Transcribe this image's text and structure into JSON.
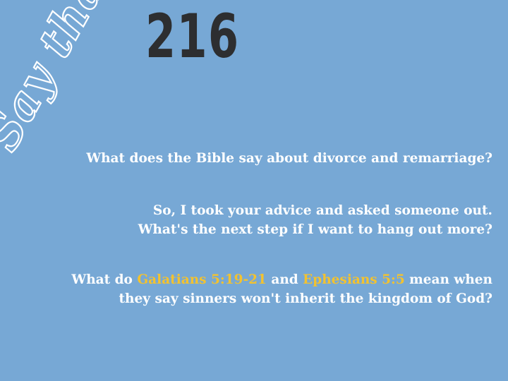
{
  "logo": {
    "text": "Say that."
  },
  "episode": {
    "number": "216"
  },
  "questions": {
    "q1": {
      "line1": "What does the Bible say about divorce and remarriage?"
    },
    "q2": {
      "line1": "So, I took your advice and asked someone out.",
      "line2": "What's the next step if I want to hang out more?"
    },
    "q3": {
      "line1_prefix": "What do ",
      "ref1": "Galatians 5:19-21",
      "line1_middle": " and ",
      "ref2": "Ephesians 5:5",
      "line1_suffix": " mean when",
      "line2": "they say sinners won't inherit the kingdom of God?"
    }
  },
  "colors": {
    "background": "#77a8d5",
    "number": "#2d2e30",
    "text": "#ffffff",
    "reference": "#f2c230"
  }
}
